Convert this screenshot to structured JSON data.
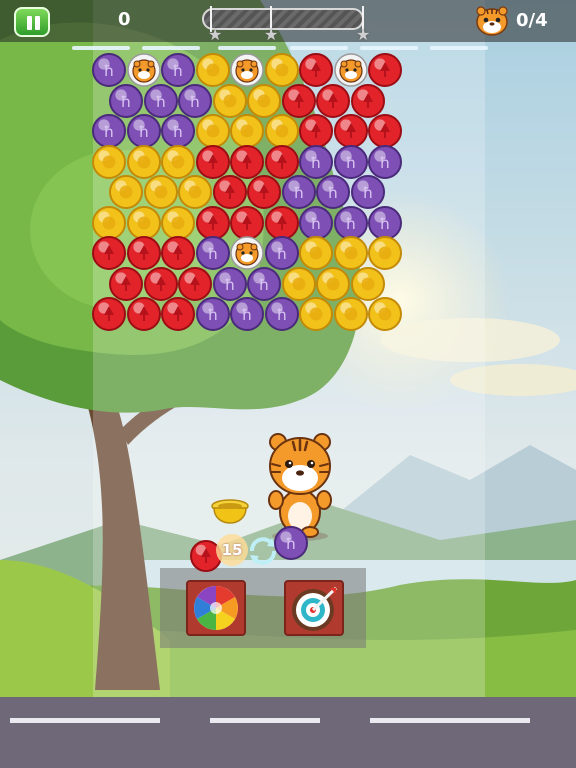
{
  "hud": {
    "score": "0",
    "goal_count": "0/4",
    "progress_fraction": 0,
    "stars_total": 3,
    "pause_icon": "pause-icon",
    "goal_icon": "tiger-face-icon"
  },
  "colors": {
    "red": "#e2232a",
    "yellow": "#f2c21b",
    "purple": "#7e4fb5",
    "accent_green": "#3bb33a"
  },
  "shooter": {
    "shots_left": "15",
    "next_bubble": "red",
    "current_bubble": "purple",
    "swap_icon": "swap-icon",
    "character": "tiger-mascot"
  },
  "boosters": [
    {
      "name": "rainbow-bubble-booster",
      "icon": "rainbow-swirl-icon"
    },
    {
      "name": "aim-target-booster",
      "icon": "target-icon"
    }
  ],
  "board": {
    "rows": [
      [
        "purple",
        "tiger",
        "purple",
        "yellow",
        "tiger",
        "yellow",
        "red",
        "tiger",
        "red"
      ],
      [
        "purple",
        "purple",
        "purple",
        "yellow",
        "yellow",
        "red",
        "red",
        "red"
      ],
      [
        "purple",
        "purple",
        "purple",
        "yellow",
        "yellow",
        "yellow",
        "red",
        "red",
        "red"
      ],
      [
        "yellow",
        "yellow",
        "yellow",
        "red",
        "red",
        "red",
        "purple",
        "purple",
        "purple"
      ],
      [
        "yellow",
        "yellow",
        "yellow",
        "red",
        "red",
        "purple",
        "purple",
        "purple"
      ],
      [
        "yellow",
        "yellow",
        "yellow",
        "red",
        "red",
        "red",
        "purple",
        "purple",
        "purple"
      ],
      [
        "red",
        "red",
        "red",
        "purple",
        "tiger",
        "purple",
        "yellow",
        "yellow",
        "yellow"
      ],
      [
        "red",
        "red",
        "red",
        "purple",
        "purple",
        "yellow",
        "yellow",
        "yellow"
      ],
      [
        "red",
        "red",
        "red",
        "purple",
        "purple",
        "purple",
        "yellow",
        "yellow",
        "yellow"
      ]
    ]
  }
}
